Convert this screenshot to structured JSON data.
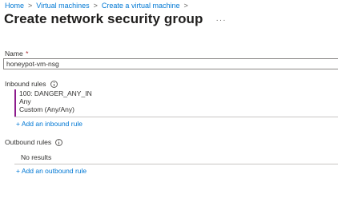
{
  "breadcrumb": {
    "items": [
      "Home",
      "Virtual machines",
      "Create a virtual machine"
    ],
    "separator": ">"
  },
  "header": {
    "title": "Create network security group",
    "more_label": "···"
  },
  "name_field": {
    "label": "Name",
    "required_mark": "*",
    "value": "honeypot-vm-nsg"
  },
  "inbound": {
    "label": "Inbound rules",
    "rules": [
      {
        "name": "100: DANGER_ANY_IN",
        "source": "Any",
        "service": "Custom (Any/Any)"
      }
    ],
    "add_label": "+ Add an inbound rule"
  },
  "outbound": {
    "label": "Outbound rules",
    "empty_text": "No results",
    "add_label": "+ Add an outbound rule"
  },
  "colors": {
    "link": "#0078d4",
    "rule_accent": "#8c1b8c",
    "required": "#a4262c"
  }
}
